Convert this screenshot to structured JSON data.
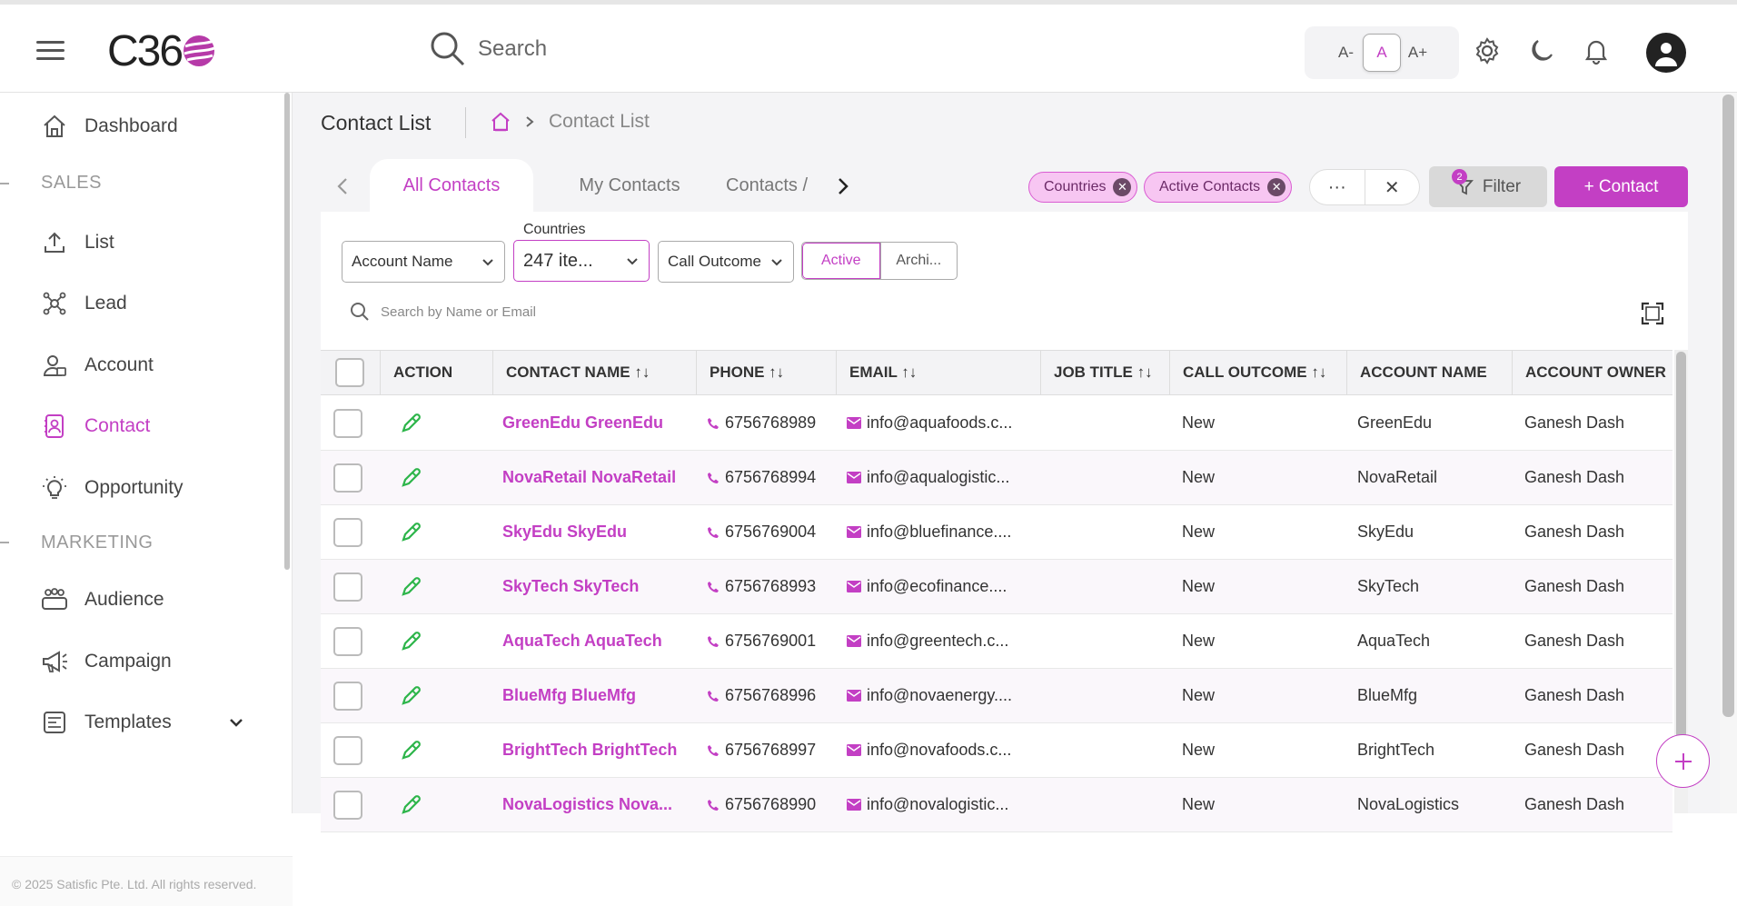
{
  "brand": {
    "logo_text": "C36",
    "accent": "#c33fc4"
  },
  "header": {
    "search_placeholder": "Search",
    "font_controls": [
      "A-",
      "A",
      "A+"
    ]
  },
  "sidebar": {
    "items": [
      {
        "label": "Dashboard",
        "icon": "home-icon"
      },
      {
        "label": "SALES",
        "type": "section"
      },
      {
        "label": "List",
        "icon": "upload-icon"
      },
      {
        "label": "Lead",
        "icon": "network-icon"
      },
      {
        "label": "Account",
        "icon": "user-card-icon"
      },
      {
        "label": "Contact",
        "icon": "contact-icon"
      },
      {
        "label": "Opportunity",
        "icon": "lightbulb-icon"
      },
      {
        "label": "MARKETING",
        "type": "section"
      },
      {
        "label": "Audience",
        "icon": "group-icon"
      },
      {
        "label": "Campaign",
        "icon": "megaphone-icon"
      },
      {
        "label": "Templates",
        "icon": "template-icon"
      }
    ],
    "footer": "© 2025 Satisfic Pte. Ltd. All rights reserved."
  },
  "page": {
    "title": "Contact List",
    "breadcrumb_current": "Contact List"
  },
  "tabs": [
    "All Contacts",
    "My Contacts",
    "Contacts /"
  ],
  "chips": [
    "Countries",
    "Active Contacts"
  ],
  "toolbar": {
    "more": "···",
    "clear": "✕",
    "filter_label": "Filter",
    "filter_count": "2",
    "add_contact_label": "+ Contact"
  },
  "filters": {
    "account_name": "Account Name",
    "countries_label": "Countries",
    "countries_value": "247 ite...",
    "call_outcome": "Call Outcome",
    "status_active": "Active",
    "status_archived": "Archi..."
  },
  "table": {
    "search_placeholder": "Search by Name or Email",
    "columns": [
      "ACTION",
      "CONTACT NAME ↑↓",
      "PHONE ↑↓",
      "EMAIL ↑↓",
      "JOB TITLE ↑↓",
      "CALL OUTCOME ↑↓",
      "ACCOUNT NAME",
      "ACCOUNT OWNER"
    ],
    "rows": [
      {
        "name": "GreenEdu GreenEdu",
        "phone": "6756768989",
        "email": "info@aquafoods.c...",
        "job": "",
        "outcome": "New",
        "account": "GreenEdu",
        "owner": "Ganesh Dash"
      },
      {
        "name": "NovaRetail NovaRetail",
        "phone": "6756768994",
        "email": "info@aqualogistic...",
        "job": "",
        "outcome": "New",
        "account": "NovaRetail",
        "owner": "Ganesh Dash"
      },
      {
        "name": "SkyEdu SkyEdu",
        "phone": "6756769004",
        "email": "info@bluefinance....",
        "job": "",
        "outcome": "New",
        "account": "SkyEdu",
        "owner": "Ganesh Dash"
      },
      {
        "name": "SkyTech SkyTech",
        "phone": "6756768993",
        "email": "info@ecofinance....",
        "job": "",
        "outcome": "New",
        "account": "SkyTech",
        "owner": "Ganesh Dash"
      },
      {
        "name": "AquaTech AquaTech",
        "phone": "6756769001",
        "email": "info@greentech.c...",
        "job": "",
        "outcome": "New",
        "account": "AquaTech",
        "owner": "Ganesh Dash"
      },
      {
        "name": "BlueMfg BlueMfg",
        "phone": "6756768996",
        "email": "info@novaenergy....",
        "job": "",
        "outcome": "New",
        "account": "BlueMfg",
        "owner": "Ganesh Dash"
      },
      {
        "name": "BrightTech BrightTech",
        "phone": "6756768997",
        "email": "info@novafoods.c...",
        "job": "",
        "outcome": "New",
        "account": "BrightTech",
        "owner": "Ganesh Dash"
      },
      {
        "name": "NovaLogistics Nova...",
        "phone": "6756768990",
        "email": "info@novalogistic...",
        "job": "",
        "outcome": "New",
        "account": "NovaLogistics",
        "owner": "Ganesh Dash"
      }
    ]
  }
}
